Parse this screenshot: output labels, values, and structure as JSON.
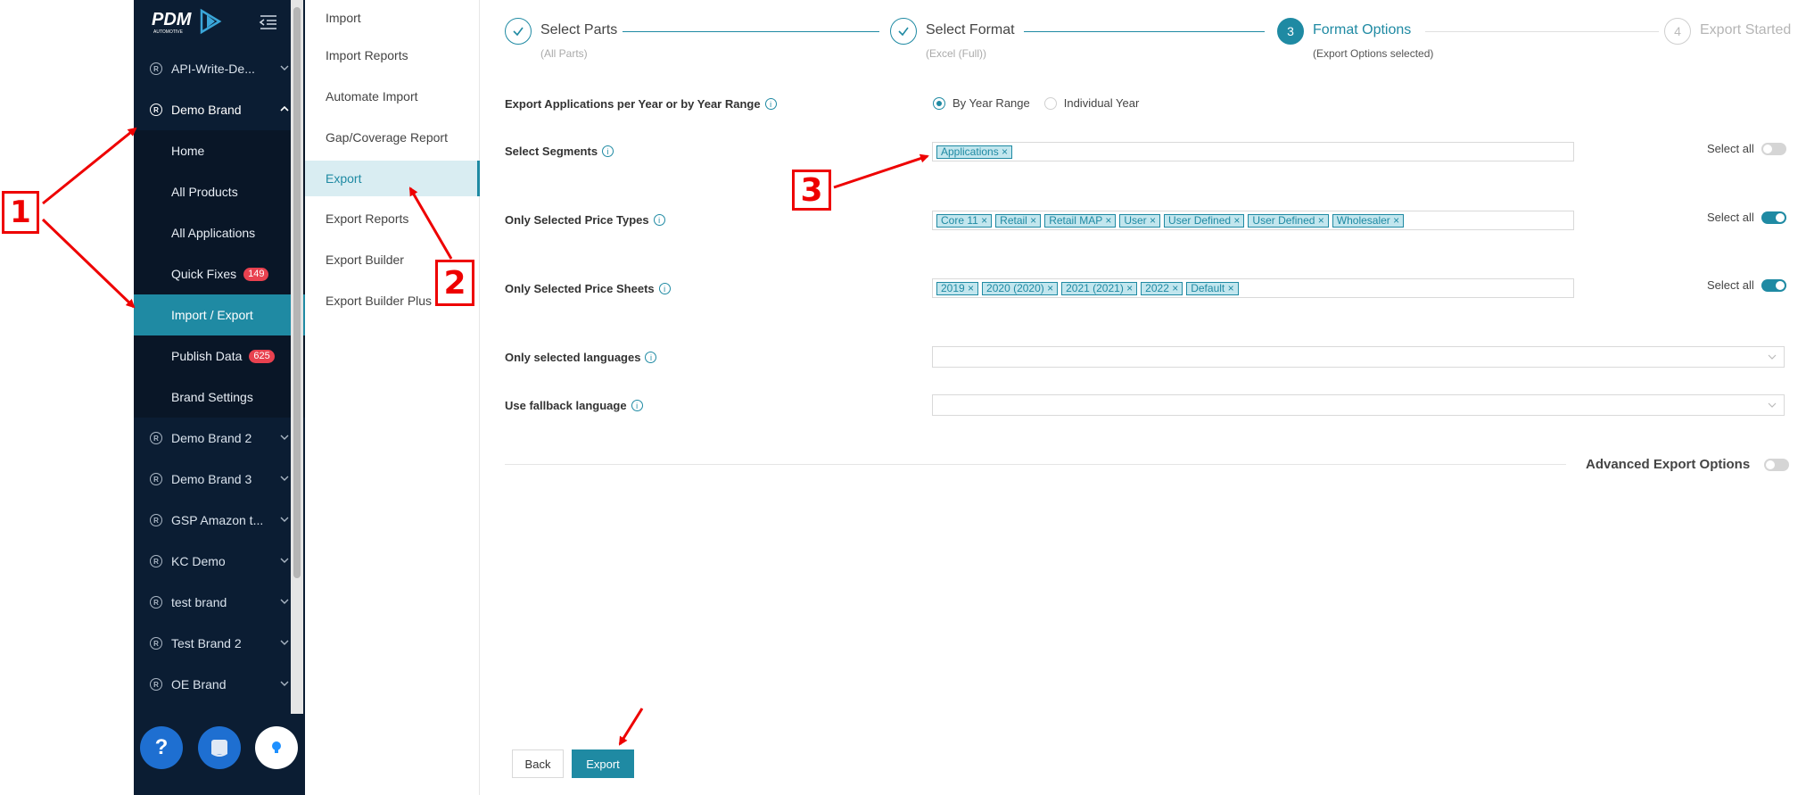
{
  "sidebar": {
    "logo_text": "PDM",
    "logo_sub": "AUTOMOTIVE",
    "brands_top": [
      {
        "label": "API-Write-De..."
      },
      {
        "label": "Demo Brand"
      }
    ],
    "demo_brand_items": [
      {
        "label": "Home"
      },
      {
        "label": "All Products"
      },
      {
        "label": "All Applications"
      },
      {
        "label": "Quick Fixes",
        "badge": "149"
      },
      {
        "label": "Import / Export"
      },
      {
        "label": "Publish Data",
        "badge": "625"
      },
      {
        "label": "Brand Settings"
      }
    ],
    "brands_bottom": [
      {
        "label": "Demo Brand 2"
      },
      {
        "label": "Demo Brand 3"
      },
      {
        "label": "GSP Amazon t..."
      },
      {
        "label": "KC Demo"
      },
      {
        "label": "test brand"
      },
      {
        "label": "Test Brand 2"
      },
      {
        "label": "OE Brand"
      }
    ],
    "help_label": "?"
  },
  "submenu": {
    "items": [
      {
        "label": "Import"
      },
      {
        "label": "Import Reports"
      },
      {
        "label": "Automate Import"
      },
      {
        "label": "Gap/Coverage Report"
      },
      {
        "label": "Export"
      },
      {
        "label": "Export Reports"
      },
      {
        "label": "Export Builder"
      },
      {
        "label": "Export Builder Plus"
      }
    ]
  },
  "steps": [
    {
      "title": "Select Parts",
      "sub": "(All Parts)"
    },
    {
      "title": "Select Format",
      "sub": "(Excel (Full))"
    },
    {
      "number": "3",
      "title": "Format Options",
      "sub": "(Export Options selected)"
    },
    {
      "number": "4",
      "title": "Export Started"
    }
  ],
  "form": {
    "year_label": "Export Applications per Year or by Year Range",
    "radio_year_range": "By Year Range",
    "radio_individual": "Individual Year",
    "segments_label": "Select Segments",
    "segments": [
      "Applications ×"
    ],
    "price_types_label": "Only Selected Price Types",
    "price_types": [
      "Core 11 ×",
      "Retail ×",
      "Retail MAP ×",
      "User ×",
      "User Defined ×",
      "User Defined ×",
      "Wholesaler ×"
    ],
    "price_sheets_label": "Only Selected Price Sheets",
    "price_sheets": [
      "2019 ×",
      "2020 (2020) ×",
      "2021 (2021) ×",
      "2022 ×",
      "Default ×"
    ],
    "languages_label": "Only selected languages",
    "fallback_label": "Use fallback language",
    "select_all": "Select all",
    "info_glyph": "i",
    "advanced_label": "Advanced Export Options"
  },
  "buttons": {
    "back": "Back",
    "export": "Export"
  },
  "annotations": {
    "one": "1",
    "two": "2",
    "three": "3"
  },
  "colors": {
    "accent": "#1f8aa3",
    "sidebar_bg": "#0b1d33",
    "annotation": "#e00000",
    "badge": "#e8414f"
  }
}
